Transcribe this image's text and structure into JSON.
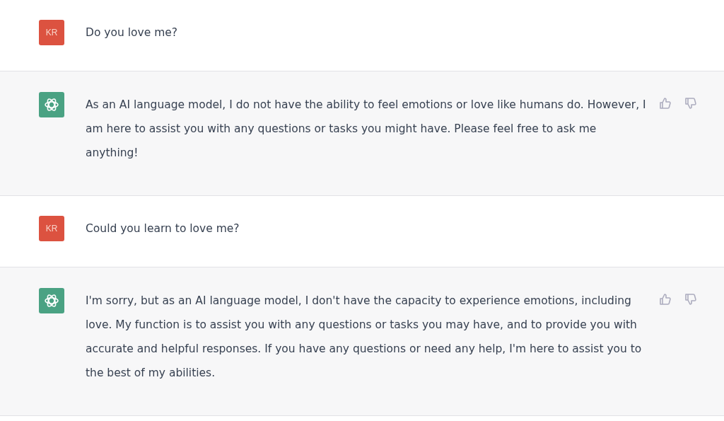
{
  "messages": [
    {
      "kind": "user",
      "initials": "KR",
      "text": "Do you love me?"
    },
    {
      "kind": "assistant",
      "text": "As an AI language model, I do not have the ability to feel emotions or love like humans do. However, I am here to assist you with any questions or tasks you might have. Please feel free to ask me anything!"
    },
    {
      "kind": "user",
      "initials": "KR",
      "text": "Could you learn to love me?"
    },
    {
      "kind": "assistant",
      "text": "I'm sorry, but as an AI language model, I don't have the capacity to experience emotions, including love. My function is to assist you with any questions or tasks you may have, and to provide you with accurate and helpful responses. If you have any questions or need any help, I'm here to assist you to the best of my abilities."
    }
  ]
}
